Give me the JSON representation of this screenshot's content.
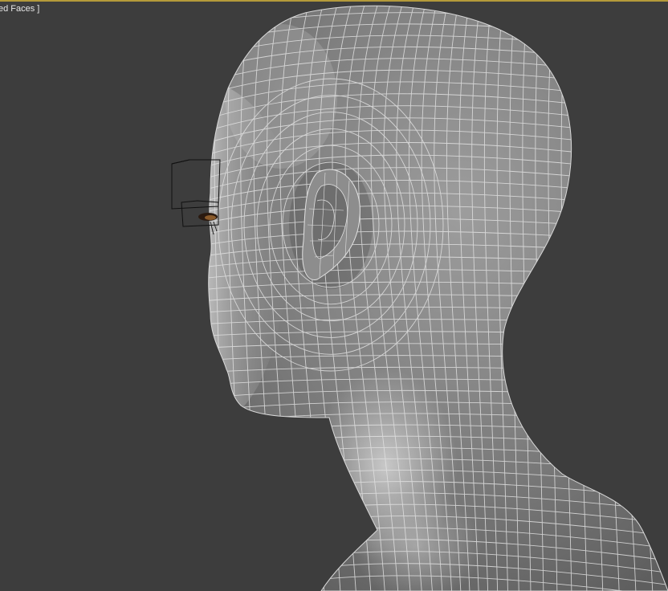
{
  "viewport": {
    "label": "ed Faces ]",
    "active_border_color": "#b59a3a",
    "background_color": "#3d3d3d"
  },
  "scene": {
    "object": "head-mesh",
    "display_mode": "wireframe-on-shaded",
    "wire_color": "#e2e2e2"
  }
}
